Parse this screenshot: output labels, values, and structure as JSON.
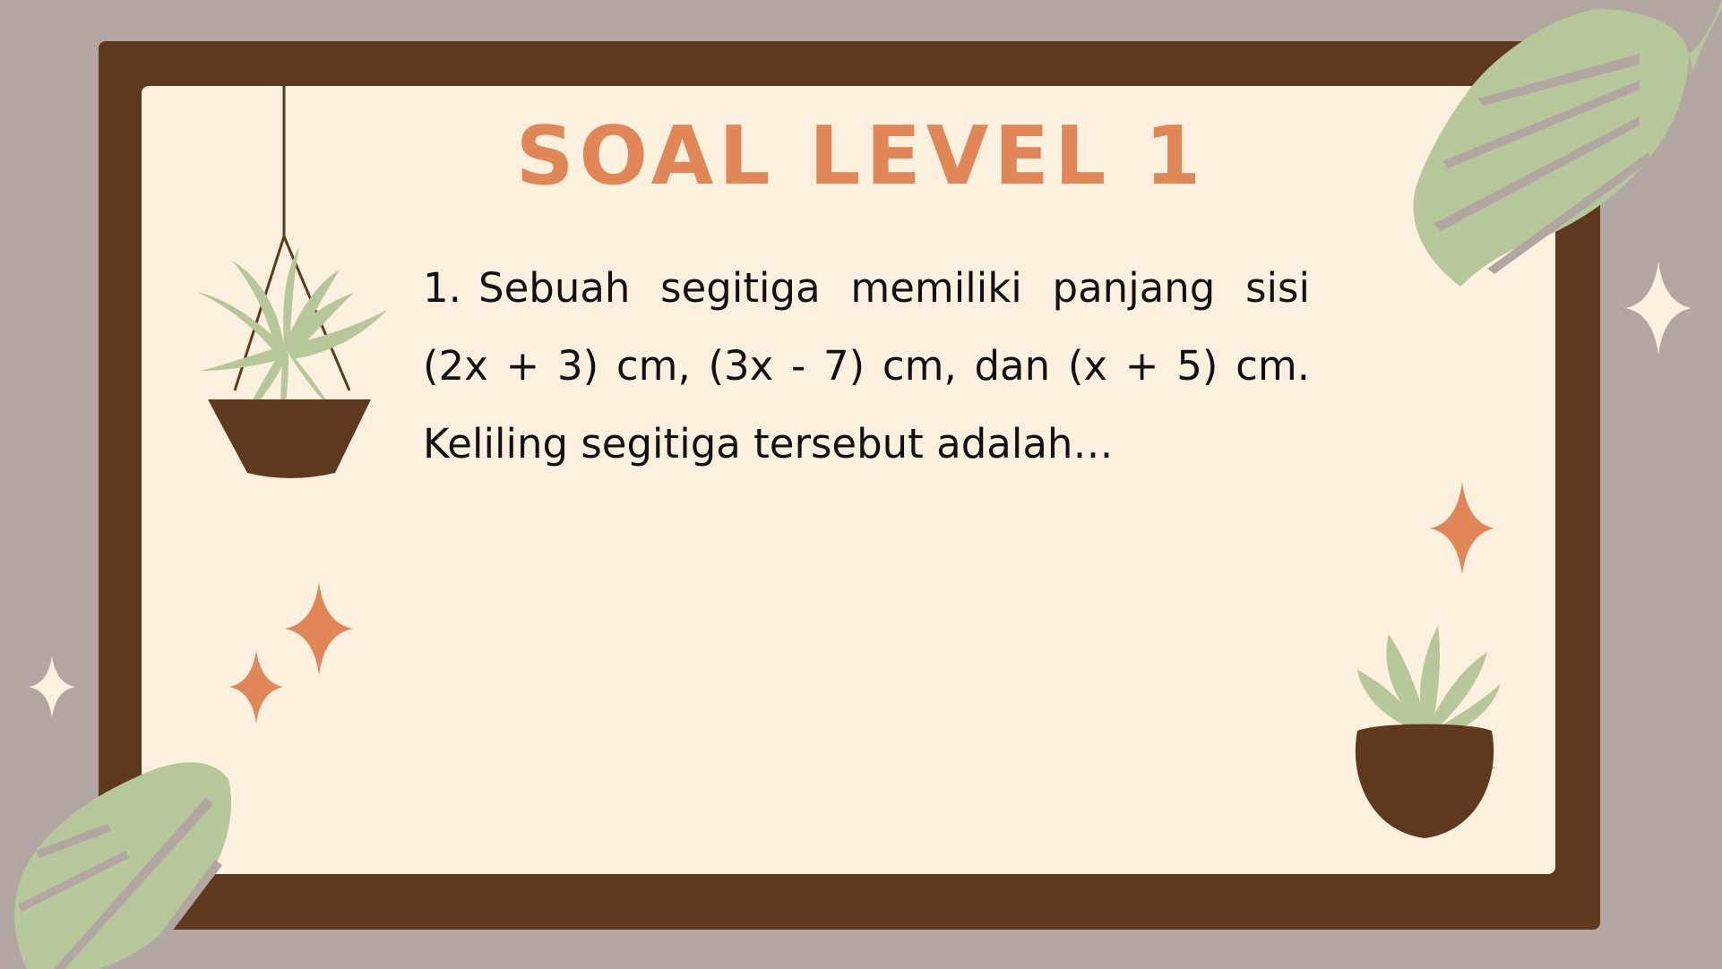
{
  "slide": {
    "title": "SOAL LEVEL 1",
    "question": {
      "number": "1.",
      "text": "Sebuah segitiga memiliki panjang sisi (2x + 3) cm, (3x - 7) cm, dan (x + 5) cm. Keliling segitiga tersebut adalah…"
    }
  },
  "decorations": {
    "icons": [
      "hanging-plant-icon",
      "monstera-leaf-icon",
      "potted-plant-icon",
      "sparkle-icon"
    ]
  },
  "colors": {
    "background": "#b2a6a2",
    "frame": "#5e391e",
    "card": "#fef0df",
    "title": "#e08657",
    "leaf": "#b6c79a",
    "sparkle_orange": "#e08657",
    "sparkle_cream": "#fef0df"
  }
}
